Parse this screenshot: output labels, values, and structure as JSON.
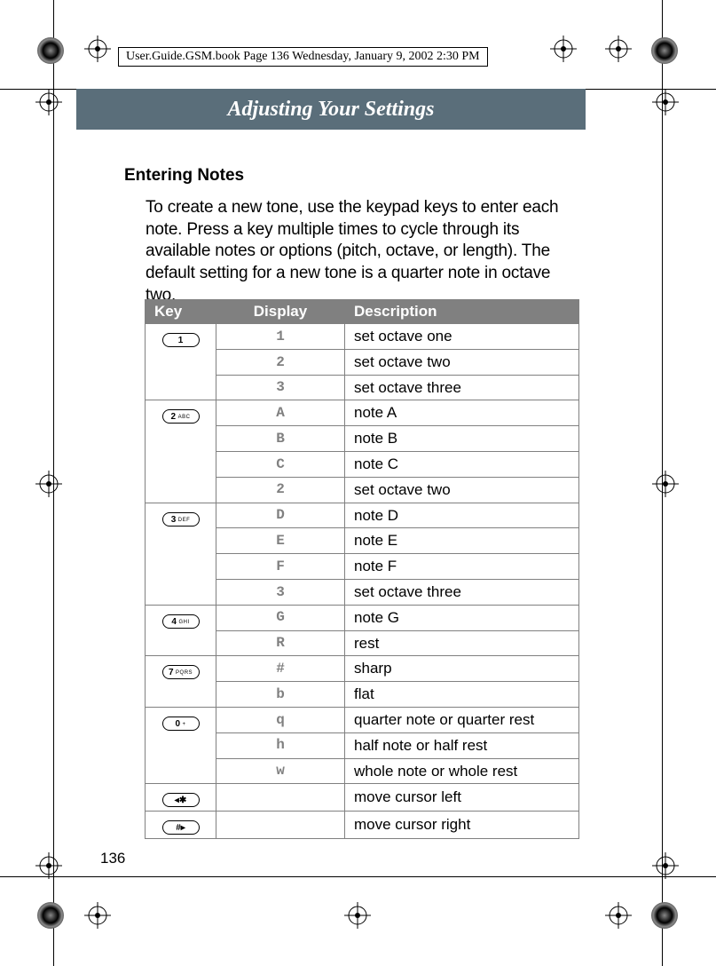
{
  "header": {
    "doc_info": "User.Guide.GSM.book  Page 136  Wednesday, January 9, 2002  2:30 PM"
  },
  "chapter": {
    "title": "Adjusting Your Settings"
  },
  "section": {
    "heading": "Entering Notes",
    "paragraph": "To create a new tone, use the keypad keys to enter each note. Press a key multiple times to cycle through its available notes or options (pitch, octave, or length). The default setting for a new tone is a quarter note in octave two."
  },
  "table": {
    "headers": {
      "key": "Key",
      "display": "Display",
      "description": "Description"
    },
    "groups": [
      {
        "key_main": "1",
        "key_sub": "",
        "rows": [
          {
            "display": "1",
            "desc": "set octave one"
          },
          {
            "display": "2",
            "desc": "set octave two"
          },
          {
            "display": "3",
            "desc": "set octave three"
          }
        ]
      },
      {
        "key_main": "2",
        "key_sub": "ABC",
        "rows": [
          {
            "display": "A",
            "desc": "note A"
          },
          {
            "display": "B",
            "desc": "note B"
          },
          {
            "display": "C",
            "desc": "note C"
          },
          {
            "display": "2",
            "desc": "set octave two"
          }
        ]
      },
      {
        "key_main": "3",
        "key_sub": "DEF",
        "rows": [
          {
            "display": "D",
            "desc": "note D"
          },
          {
            "display": "E",
            "desc": "note E"
          },
          {
            "display": "F",
            "desc": "note F"
          },
          {
            "display": "3",
            "desc": "set octave three"
          }
        ]
      },
      {
        "key_main": "4",
        "key_sub": "GHI",
        "rows": [
          {
            "display": "G",
            "desc": "note G"
          },
          {
            "display": "R",
            "desc": "rest"
          }
        ]
      },
      {
        "key_main": "7",
        "key_sub": "PQRS",
        "rows": [
          {
            "display": "#",
            "desc": "sharp"
          },
          {
            "display": "b",
            "desc": "flat"
          }
        ]
      },
      {
        "key_main": "0",
        "key_sub": "+",
        "rows": [
          {
            "display": "q",
            "desc": "quarter note or quarter rest"
          },
          {
            "display": "h",
            "desc": "half note or half rest"
          },
          {
            "display": "w",
            "desc": "whole note or whole rest"
          }
        ]
      },
      {
        "key_main": "◂✱",
        "key_sub": "",
        "rows": [
          {
            "display": "",
            "desc": "move cursor left"
          }
        ]
      },
      {
        "key_main": "#▸",
        "key_sub": "",
        "rows": [
          {
            "display": "",
            "desc": "move cursor right"
          }
        ]
      }
    ]
  },
  "page_number": "136"
}
